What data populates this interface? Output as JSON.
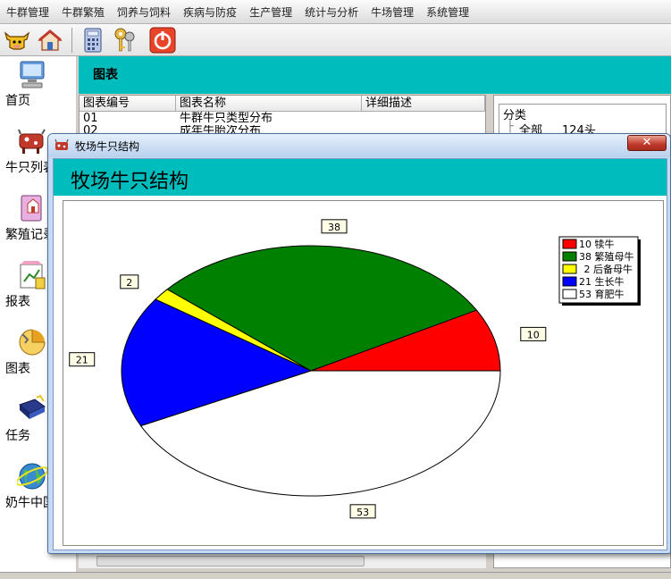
{
  "menu": [
    "牛群管理",
    "牛群繁殖",
    "饲养与饲料",
    "疾病与防疫",
    "生产管理",
    "统计与分析",
    "牛场管理",
    "系统管理"
  ],
  "toolbar": {
    "icons": [
      "cow-icon",
      "home-icon",
      "calculator-icon",
      "keys-icon",
      "power-icon"
    ]
  },
  "nav": [
    {
      "label": "首页",
      "icon": "computer-icon"
    },
    {
      "label": "牛只列表",
      "icon": "cow-icon"
    },
    {
      "label": "繁殖记录",
      "icon": "book-icon"
    },
    {
      "label": "报表",
      "icon": "report-icon"
    },
    {
      "label": "图表",
      "icon": "chart-icon"
    },
    {
      "label": "任务",
      "icon": "task-icon"
    },
    {
      "label": "奶牛中国",
      "icon": "globe-icon"
    }
  ],
  "background": {
    "title": "图表",
    "columns": [
      "图表编号",
      "图表名称",
      "详细描述"
    ],
    "rows": [
      {
        "id": "01",
        "name": "牛群牛只类型分布"
      },
      {
        "id": "02",
        "name": "成年牛胎次分布"
      }
    ],
    "tree": {
      "header": "分类",
      "all": "全部",
      "count": "124头"
    }
  },
  "dialog": {
    "window_title": "牧场牛只结构",
    "heading": "牧场牛只结构",
    "close_label": "✕"
  },
  "chart_data": {
    "type": "pie",
    "title": "牧场牛只结构",
    "slices": [
      {
        "label": "犊牛",
        "value": 10,
        "color": "#ff0000"
      },
      {
        "label": "繁殖母牛",
        "value": 38,
        "color": "#008000"
      },
      {
        "label": "后备母牛",
        "value": 2,
        "color": "#ffff00"
      },
      {
        "label": "生长牛",
        "value": 21,
        "color": "#0000ff"
      },
      {
        "label": "育肥牛",
        "value": 53,
        "color": "#ffffff"
      }
    ],
    "legend_position": "top-right"
  }
}
